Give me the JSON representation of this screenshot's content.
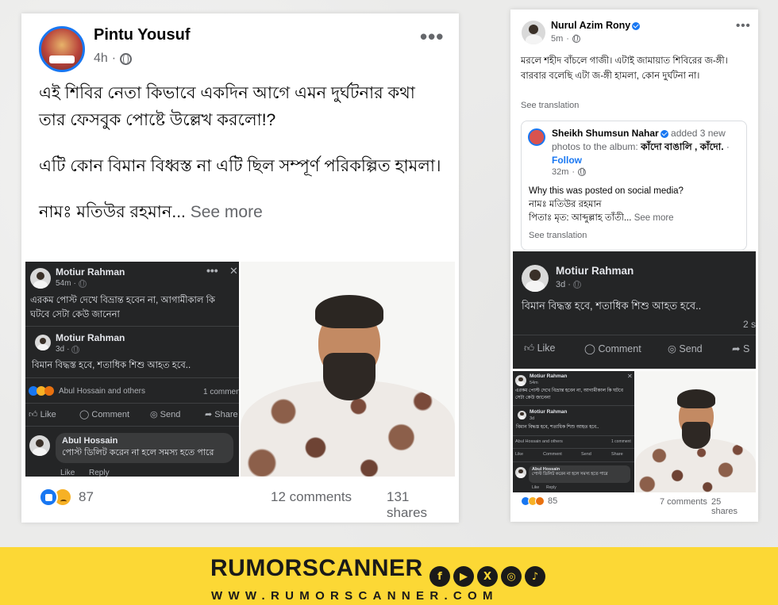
{
  "left_post": {
    "author": "Pintu Yousuf",
    "time": "4h",
    "separator": "·",
    "more_icon": "•••",
    "paragraphs": [
      "এই শিবির নেতা কিভাবে একদিন আগে এমন দুর্ঘটনার কথা তার ফেসবুক পোষ্টে উল্লেখ করলো!?",
      "এটি কোন বিমান বিধ্বস্ত না এটি ছিল সম্পূর্ণ পরিকল্পিত হামলা।"
    ],
    "last_line": "নামঃ মতিউর রহমান...",
    "see_more": "See more",
    "embed": {
      "author1": "Motiur Rahman",
      "time1": "54m",
      "text1": "এরকম পোস্ট দেখে বিভ্রান্ত হবেন না, আগামীকাল কি ঘটবে সেটা কেউ জানেনা",
      "author2": "Motiur Rahman",
      "time2": "3d",
      "text2": "বিমান বিদ্ধস্ত হবে, শতাধিক  শিশু আহত হবে..",
      "reactors": "Abul Hossain and others",
      "comment_count": "1 comment",
      "like": "Like",
      "comment": "Comment",
      "send": "Send",
      "share": "Share",
      "commenter": "Abul Hossain",
      "comment_text": "পোস্ট ডিলিট করেন না হলে সমস্য হতে পারে",
      "like_reply": "Like",
      "reply": "Reply"
    },
    "reaction_count": "87",
    "comments": "12 comments",
    "shares": "131 shares"
  },
  "right_post": {
    "author": "Nurul Azim Rony",
    "time": "5m",
    "more_icon": "•••",
    "text_line1": "মরলে শহীদ বাঁচলে গাজী। এটাই জামায়াত শিবিরের জ-ঙ্গী।",
    "text_line2": "বারবার বলেছি এটা জ-ঙ্গী হামলা, কোন দুর্ঘটনা না।",
    "see_translation": "See translation",
    "shared": {
      "author": "Sheikh Shumsun Nahar",
      "action": "added 3 new photos to the album:",
      "album": "কাঁদো বাঙালি , কাঁদো.",
      "follow": "Follow",
      "time": "32m",
      "line1": "Why this was posted on social media?",
      "line2": "নামঃ মতিউর রহমান",
      "line3": "পিতাঃ মৃত: আব্দুল্লাহ তাঁতী...",
      "see_more": "See more",
      "see_translation": "See translation"
    },
    "embed": {
      "author": "Motiur Rahman",
      "time": "3d",
      "text": "বিমান বিদ্ধস্ত হবে, শতাধিক  শিশু আহত হবে..",
      "side_text": "2 s",
      "like": "Like",
      "comment": "Comment",
      "send": "Send",
      "share": "S"
    },
    "mini": {
      "author1": "Motiur Rahman",
      "time1": "54m",
      "text1": "এরকম পোস্ট দেখে বিভ্রান্ত হবেন না, আগামীকাল কি ঘটবে সেটা কেউ জানেনা",
      "author2": "Motiur Rahman",
      "time2": "3d",
      "text2": "বিমান বিদ্ধস্ত হবে, শতাধিক শিশু আহত হবে..",
      "reactors": "Abul Hossain and others",
      "comment_count": "1 comment",
      "like": "Like",
      "comment": "Comment",
      "send": "Send",
      "share": "Share",
      "commenter": "Abul Hossain",
      "comment_text": "পোস্ট ডিলিট করেন না হলে সমস্য হতে পারে",
      "like_reply": "Like",
      "reply": "Reply"
    },
    "reaction_count": "85",
    "comments": "7 comments",
    "shares": "25 shares"
  },
  "brand": {
    "name": "RUMORSCANNER",
    "url": "WWW.RUMORSCANNER.COM",
    "social_icons": [
      "facebook-icon",
      "youtube-icon",
      "x-icon",
      "instagram-icon",
      "tiktok-icon"
    ],
    "social_glyphs": [
      "f",
      "▶",
      "X",
      "◎",
      "♪"
    ],
    "colors": {
      "bar": "#fcd835",
      "text": "#1a1a1a"
    }
  },
  "colors": {
    "facebook_blue": "#1877f2",
    "dark_embed": "#242526",
    "meta_gray": "#65676b"
  }
}
